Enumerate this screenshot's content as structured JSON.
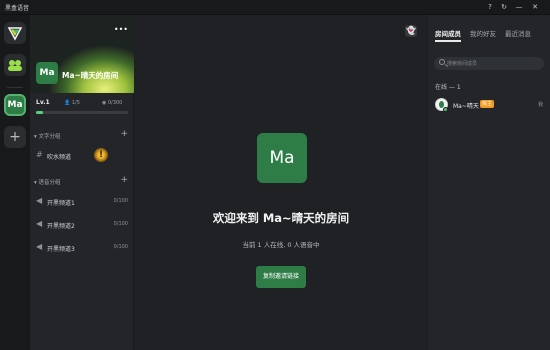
{
  "app": {
    "title": "黑盒语音"
  },
  "window_controls": {
    "help": "?",
    "refresh": "↻",
    "minimize": "—",
    "close": "✕"
  },
  "rail": {
    "server_abbrev": "Ma",
    "add_label": "+"
  },
  "room": {
    "name": "Ma~晴天的房间",
    "avatar_text": "Ma",
    "more": "•••",
    "level": "Lv.1",
    "members": "1/5",
    "online": "0/300",
    "progress": 0.08
  },
  "text_group": {
    "header": "▾ 文字分组",
    "add": "+",
    "channels": [
      {
        "name": "吹水频道",
        "icon": "#"
      }
    ],
    "alert": "!"
  },
  "voice_group": {
    "header": "▾ 语音分组",
    "add": "+",
    "channels": [
      {
        "name": "开黑频道1",
        "count": "0/100",
        "icon": "◀"
      },
      {
        "name": "开黑频道2",
        "count": "0/100",
        "icon": "◀"
      },
      {
        "name": "开黑频道3",
        "count": "0/100",
        "icon": "◀"
      }
    ]
  },
  "main": {
    "avatar_text": "Ma",
    "welcome": "欢迎来到 Ma~晴天的房间",
    "status": "当前 1 人在线, 0 人语音中",
    "invite_button": "复制邀请链接",
    "ghost_icon": "👻"
  },
  "right_panel": {
    "tabs": [
      "房间成员",
      "我的好友",
      "最近消息"
    ],
    "search_placeholder": "搜索房间成员",
    "online_header": "在线 — 1",
    "members": [
      {
        "name": "Ma~晴天",
        "badge": "房主",
        "extra": "我"
      }
    ]
  }
}
